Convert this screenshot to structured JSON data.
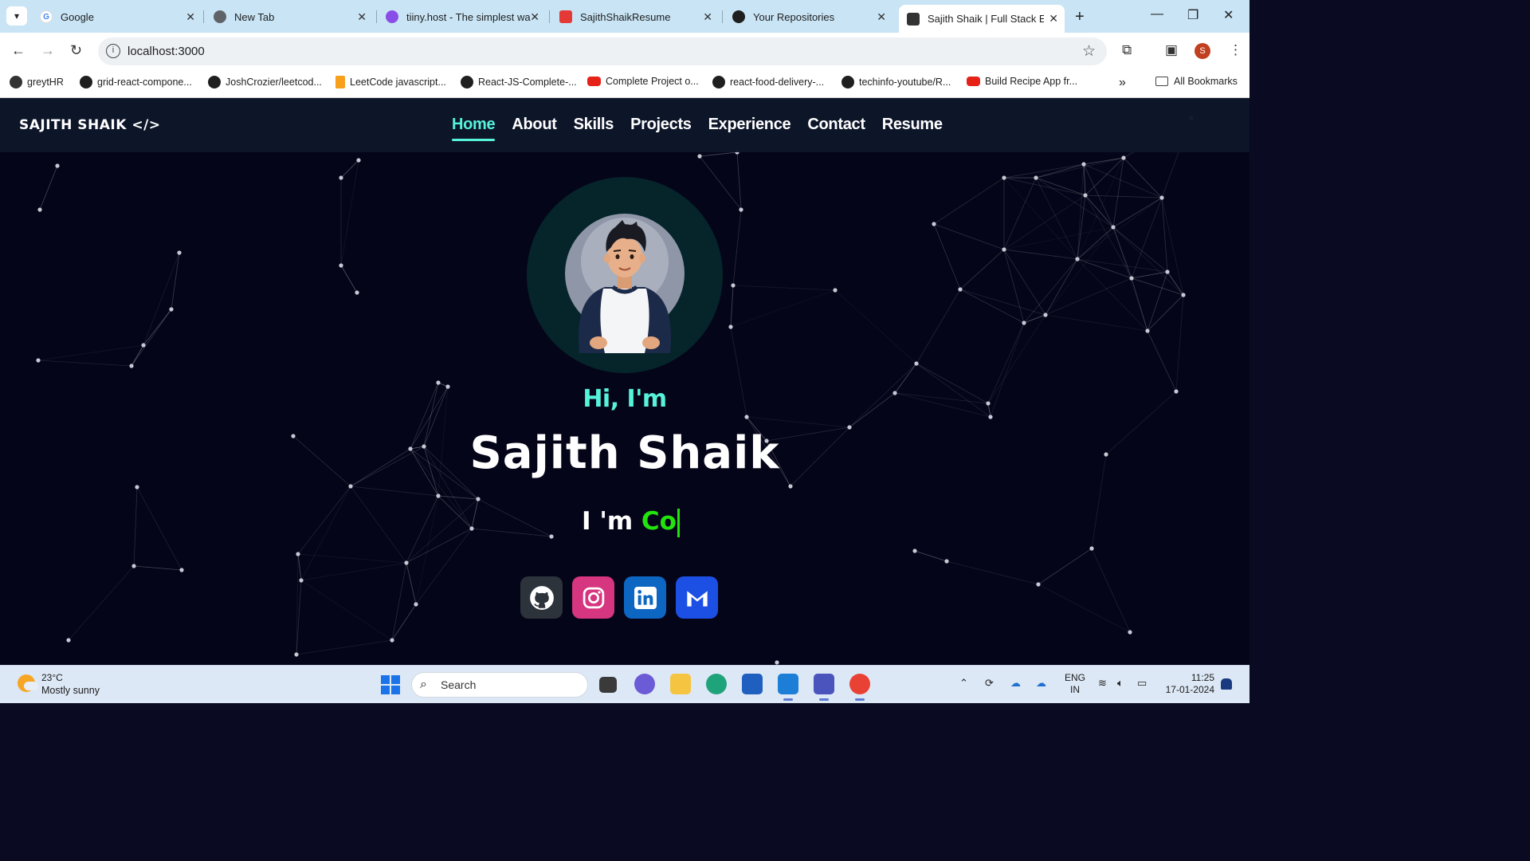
{
  "browser": {
    "tabs": [
      {
        "title": "Google",
        "icon": "google-icon"
      },
      {
        "title": "New Tab",
        "icon": "chrome-icon"
      },
      {
        "title": "tiiny.host - The simplest wa",
        "icon": "tiiny-icon"
      },
      {
        "title": "SajithShaikResume",
        "icon": "pdf-icon"
      },
      {
        "title": "Your Repositories",
        "icon": "github-icon"
      },
      {
        "title": "Sajith Shaik | Full Stack Eng",
        "icon": "site-icon"
      }
    ],
    "active_tab": 5,
    "url": "localhost:3000",
    "profile_initial": "S",
    "bookmarks": [
      {
        "label": "greytHR",
        "icon": "greythr-icon"
      },
      {
        "label": "grid-react-compone...",
        "icon": "github-icon"
      },
      {
        "label": "JoshCrozier/leetcod...",
        "icon": "github-icon"
      },
      {
        "label": "LeetCode javascript...",
        "icon": "leetcode-icon"
      },
      {
        "label": "React-JS-Complete-...",
        "icon": "github-icon"
      },
      {
        "label": "Complete Project o...",
        "icon": "youtube-icon"
      },
      {
        "label": "react-food-delivery-...",
        "icon": "github-icon"
      },
      {
        "label": "techinfo-youtube/R...",
        "icon": "github-icon"
      },
      {
        "label": "Build Recipe App fr...",
        "icon": "youtube-icon"
      }
    ],
    "all_bookmarks": "All Bookmarks"
  },
  "site": {
    "logo": "SAJITH SHAIK </>",
    "nav": [
      "Home",
      "About",
      "Skills",
      "Projects",
      "Experience",
      "Contact",
      "Resume"
    ],
    "active_nav": "Home",
    "greeting": "Hi, I'm",
    "name": "Sajith Shaik",
    "role_prefix": "I 'm",
    "role_typed": "Co",
    "socials": [
      "github-icon",
      "instagram-icon",
      "linkedin-icon",
      "gmail-icon"
    ],
    "colors": {
      "accent": "#56f2d9",
      "typed": "#22e30e",
      "background": "#05051a"
    }
  },
  "taskbar": {
    "weather_temp": "23°C",
    "weather_desc": "Mostly sunny",
    "search_label": "Search",
    "lang_line1": "ENG",
    "lang_line2": "IN",
    "time": "11:25",
    "date": "17-01-2024"
  }
}
